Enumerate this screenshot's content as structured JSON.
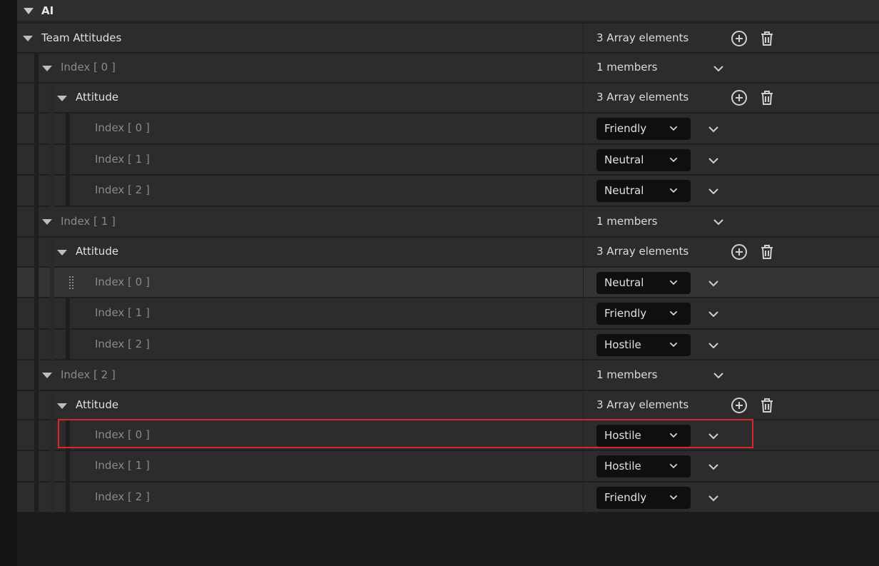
{
  "category": {
    "label": "AI"
  },
  "team_attitudes": {
    "label": "Team Attitudes",
    "value": "3 Array elements"
  },
  "teams": [
    {
      "label": "Index [ 0 ]",
      "value": "1 members",
      "attitude": {
        "label": "Attitude",
        "value": "3 Array elements",
        "entries": [
          {
            "label": "Index [ 0 ]",
            "value": "Friendly"
          },
          {
            "label": "Index [ 1 ]",
            "value": "Neutral"
          },
          {
            "label": "Index [ 2 ]",
            "value": "Neutral"
          }
        ]
      }
    },
    {
      "label": "Index [ 1 ]",
      "value": "1 members",
      "attitude": {
        "label": "Attitude",
        "value": "3 Array elements",
        "entries": [
          {
            "label": "Index [ 0 ]",
            "value": "Neutral"
          },
          {
            "label": "Index [ 1 ]",
            "value": "Friendly"
          },
          {
            "label": "Index [ 2 ]",
            "value": "Hostile"
          }
        ]
      }
    },
    {
      "label": "Index [ 2 ]",
      "value": "1 members",
      "attitude": {
        "label": "Attitude",
        "value": "3 Array elements",
        "entries": [
          {
            "label": "Index [ 0 ]",
            "value": "Hostile"
          },
          {
            "label": "Index [ 1 ]",
            "value": "Hostile"
          },
          {
            "label": "Index [ 2 ]",
            "value": "Friendly"
          }
        ]
      }
    }
  ],
  "colors": {
    "highlight": "#d9262c",
    "row_bg": "#2c2c2c",
    "combo_bg": "#0f0f0f"
  }
}
